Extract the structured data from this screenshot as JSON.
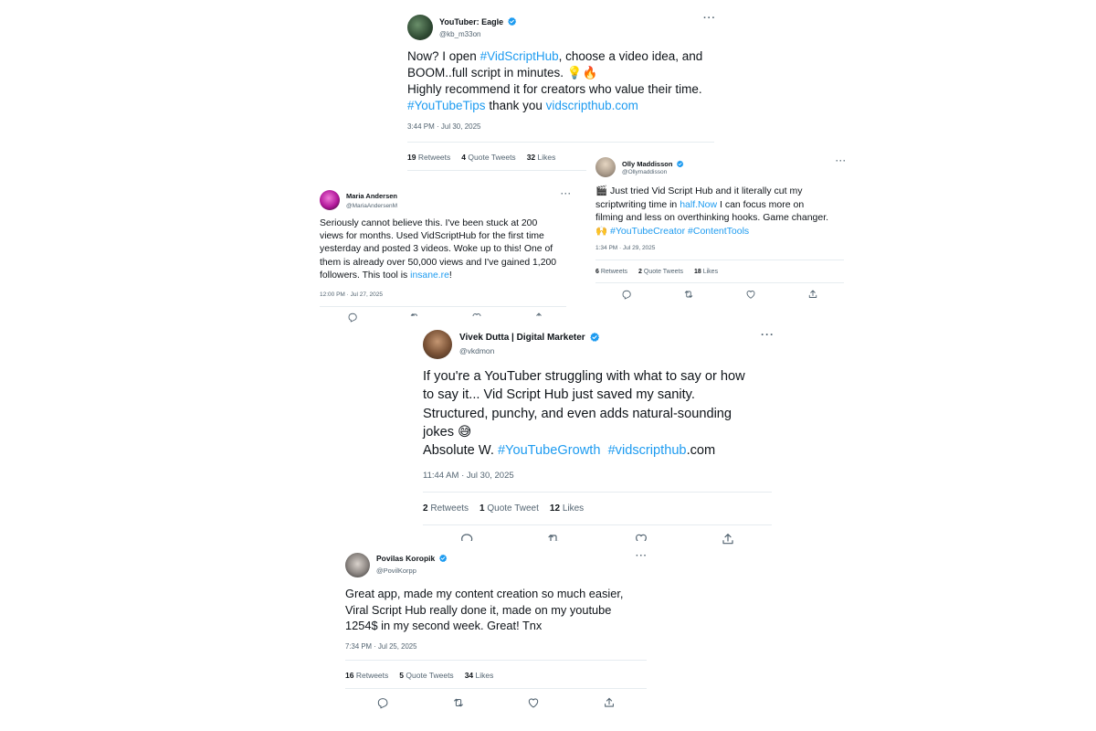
{
  "tweets": {
    "eagle": {
      "name": "YouTuber: Eagle",
      "handle": "@kb_m33on",
      "body_parts": [
        "Now? I open ",
        "#VidScriptHub",
        ", choose a video idea, and\nBOOM..full script in minutes. ",
        "💡",
        "🔥",
        "\nHighly recommend it for creators who value their time.\n",
        "#YouTubeTips",
        " thank you ",
        "vidscripthub.com"
      ],
      "time": "3:44 PM · Jul 30, 2025",
      "retweets": "19",
      "retweets_label": "Retweets",
      "quotes": "4",
      "quotes_label": "Quote Tweets",
      "likes": "32",
      "likes_label": "Likes",
      "more": "···"
    },
    "olly": {
      "name": "Olly Maddisson",
      "handle": "@Ollymaddisson",
      "body_parts": [
        "🎬",
        " Just tried Vid Script Hub and it literally cut my\nscriptwriting time in ",
        "half.Now",
        " I can focus more on\nfilming and less on overthinking hooks. Game changer.\n",
        "🙌",
        " ",
        "#YouTubeCreator",
        " ",
        "#ContentTools"
      ],
      "time": "1:34 PM · Jul 29, 2025",
      "retweets": "6",
      "retweets_label": "Retweets",
      "quotes": "2",
      "quotes_label": "Quote Tweets",
      "likes": "18",
      "likes_label": "Likes",
      "more": "···"
    },
    "maria": {
      "name": "Maria Andersen",
      "handle": "@MariaAndersenM",
      "body_parts": [
        "Seriously cannot believe this. I've been stuck at 200\nviews for months. Used VidScriptHub for the first time\nyesterday and posted 3 videos. Woke up to this! One of\nthem is already over 50,000 views and I've gained 1,200\nfollowers. This tool is ",
        "insane.re",
        "!"
      ],
      "time": "12:00 PM · Jul 27, 2025",
      "more": "···"
    },
    "vivek": {
      "name": "Vivek Dutta | Digital Marketer",
      "handle": "@vkdmon",
      "body_parts": [
        "If you're a YouTuber struggling with what to say or how\nto say it... Vid Script Hub just saved my sanity.\nStructured, punchy, and even adds natural-sounding\njokes ",
        "😅",
        "\nAbsolute W. ",
        "#YouTubeGrowth",
        "  ",
        "#vidscripthub",
        ".com"
      ],
      "time": "11:44 AM · Jul 30, 2025",
      "retweets": "2",
      "retweets_label": "Retweets",
      "quotes": "1",
      "quotes_label": "Quote Tweet",
      "likes": "12",
      "likes_label": "Likes",
      "more": "···"
    },
    "povilas": {
      "name": "Povilas Koropik",
      "handle": "@PovilKorpp",
      "body_parts": [
        "Great app, made my content creation so much easier,\nViral Script Hub really done it, made on my youtube\n1254$ in my second week. Great! Tnx"
      ],
      "time": "7:34 PM · Jul 25, 2025",
      "retweets": "16",
      "retweets_label": "Retweets",
      "quotes": "5",
      "quotes_label": "Quote Tweets",
      "likes": "34",
      "likes_label": "Likes",
      "more": "···"
    }
  },
  "icons": [
    "reply-icon",
    "retweet-icon",
    "like-icon",
    "share-icon",
    "verified-badge-icon",
    "more-options-icon"
  ],
  "colors": {
    "link": "#1d9bf0",
    "text": "#0f1419",
    "muted": "#536471",
    "divider": "#e6ecf0",
    "verified": "#1d9bf0"
  }
}
